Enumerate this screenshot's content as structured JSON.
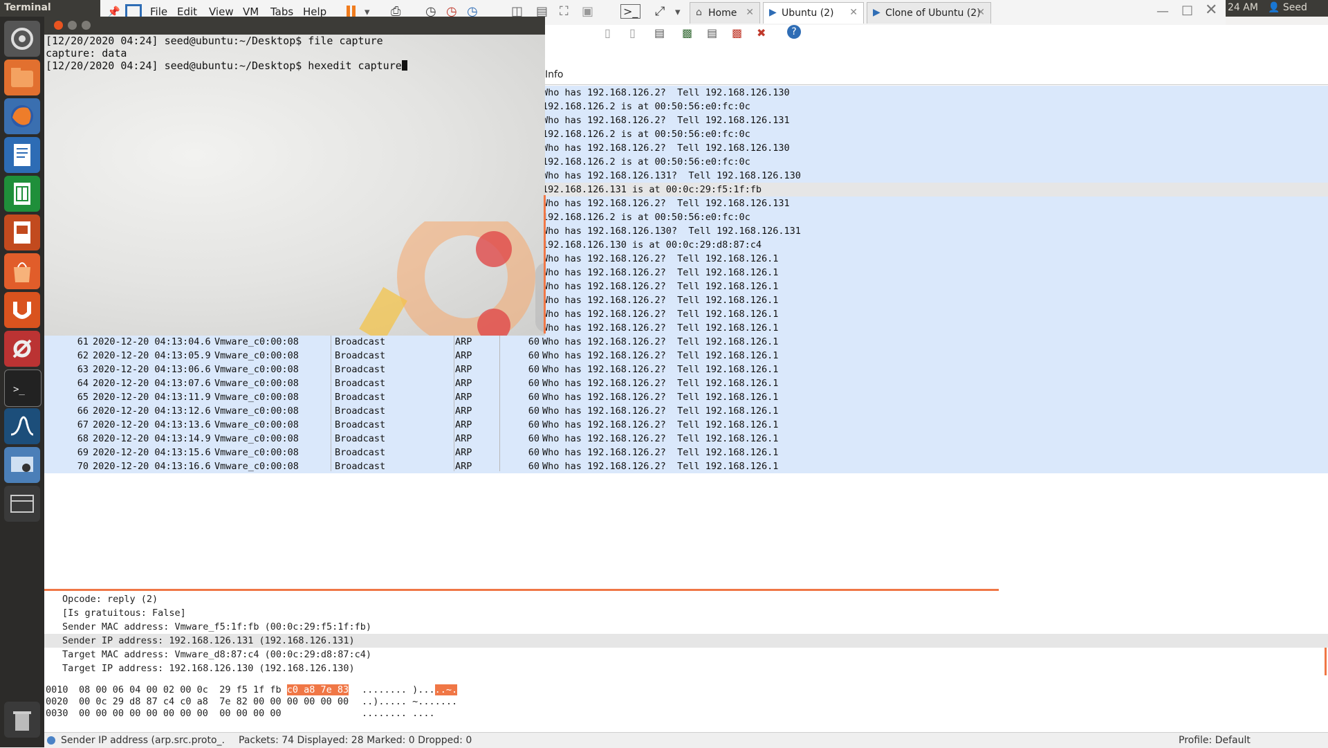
{
  "top_panel": {
    "app_title": "Terminal",
    "clock": "24 AM",
    "user": "Seed"
  },
  "vmware": {
    "menus": [
      "File",
      "Edit",
      "View",
      "VM",
      "Tabs",
      "Help"
    ],
    "tabs": [
      {
        "label": "Home",
        "icon": "home-icon"
      },
      {
        "label": "Ubuntu (2)",
        "icon": "vm-play-icon"
      },
      {
        "label": "Clone of Ubuntu (2)",
        "icon": "vm-play-icon"
      }
    ]
  },
  "terminal": {
    "lines": [
      "[12/20/2020 04:24] seed@ubuntu:~/Desktop$ file capture",
      "capture: data",
      "[12/20/2020 04:24] seed@ubuntu:~/Desktop$ hexedit capture"
    ]
  },
  "packet_list": {
    "column_header": "Info",
    "hidden_rows_info": [
      "Who has 192.168.126.2?  Tell 192.168.126.130",
      "192.168.126.2 is at 00:50:56:e0:fc:0c",
      "Who has 192.168.126.2?  Tell 192.168.126.131",
      "192.168.126.2 is at 00:50:56:e0:fc:0c",
      "Who has 192.168.126.2?  Tell 192.168.126.130",
      "192.168.126.2 is at 00:50:56:e0:fc:0c",
      "Who has 192.168.126.131?  Tell 192.168.126.130",
      "192.168.126.131 is at 00:0c:29:f5:1f:fb",
      "Who has 192.168.126.2?  Tell 192.168.126.131",
      "192.168.126.2 is at 00:50:56:e0:fc:0c",
      "Who has 192.168.126.130?  Tell 192.168.126.131",
      "192.168.126.130 is at 00:0c:29:d8:87:c4",
      "Who has 192.168.126.2?  Tell 192.168.126.1",
      "Who has 192.168.126.2?  Tell 192.168.126.1",
      "Who has 192.168.126.2?  Tell 192.168.126.1",
      "Who has 192.168.126.2?  Tell 192.168.126.1",
      "Who has 192.168.126.2?  Tell 192.168.126.1",
      "Who has 192.168.126.2?  Tell 192.168.126.1"
    ],
    "rows": [
      {
        "no": "61",
        "time": "2020-12-20 04:13:04.6",
        "src": "Vmware_c0:00:08",
        "dst": "Broadcast",
        "proto": "ARP",
        "len": "60",
        "info": "Who has 192.168.126.2?  Tell 192.168.126.1"
      },
      {
        "no": "62",
        "time": "2020-12-20 04:13:05.9",
        "src": "Vmware_c0:00:08",
        "dst": "Broadcast",
        "proto": "ARP",
        "len": "60",
        "info": "Who has 192.168.126.2?  Tell 192.168.126.1"
      },
      {
        "no": "63",
        "time": "2020-12-20 04:13:06.6",
        "src": "Vmware_c0:00:08",
        "dst": "Broadcast",
        "proto": "ARP",
        "len": "60",
        "info": "Who has 192.168.126.2?  Tell 192.168.126.1"
      },
      {
        "no": "64",
        "time": "2020-12-20 04:13:07.6",
        "src": "Vmware_c0:00:08",
        "dst": "Broadcast",
        "proto": "ARP",
        "len": "60",
        "info": "Who has 192.168.126.2?  Tell 192.168.126.1"
      },
      {
        "no": "65",
        "time": "2020-12-20 04:13:11.9",
        "src": "Vmware_c0:00:08",
        "dst": "Broadcast",
        "proto": "ARP",
        "len": "60",
        "info": "Who has 192.168.126.2?  Tell 192.168.126.1"
      },
      {
        "no": "66",
        "time": "2020-12-20 04:13:12.6",
        "src": "Vmware_c0:00:08",
        "dst": "Broadcast",
        "proto": "ARP",
        "len": "60",
        "info": "Who has 192.168.126.2?  Tell 192.168.126.1"
      },
      {
        "no": "67",
        "time": "2020-12-20 04:13:13.6",
        "src": "Vmware_c0:00:08",
        "dst": "Broadcast",
        "proto": "ARP",
        "len": "60",
        "info": "Who has 192.168.126.2?  Tell 192.168.126.1"
      },
      {
        "no": "68",
        "time": "2020-12-20 04:13:14.9",
        "src": "Vmware_c0:00:08",
        "dst": "Broadcast",
        "proto": "ARP",
        "len": "60",
        "info": "Who has 192.168.126.2?  Tell 192.168.126.1"
      },
      {
        "no": "69",
        "time": "2020-12-20 04:13:15.6",
        "src": "Vmware_c0:00:08",
        "dst": "Broadcast",
        "proto": "ARP",
        "len": "60",
        "info": "Who has 192.168.126.2?  Tell 192.168.126.1"
      },
      {
        "no": "70",
        "time": "2020-12-20 04:13:16.6",
        "src": "Vmware_c0:00:08",
        "dst": "Broadcast",
        "proto": "ARP",
        "len": "60",
        "info": "Who has 192.168.126.2?  Tell 192.168.126.1"
      }
    ]
  },
  "packet_details": [
    "Opcode: reply (2)",
    "[Is gratuitous: False]",
    "Sender MAC address: Vmware_f5:1f:fb (00:0c:29:f5:1f:fb)",
    "Sender IP address: 192.168.126.131 (192.168.126.131)",
    "Target MAC address: Vmware_d8:87:c4 (00:0c:29:d8:87:c4)",
    "Target IP address: 192.168.126.130 (192.168.126.130)"
  ],
  "hex_dump": [
    {
      "offset": "0010",
      "bytes_a": "08 00 06 04 00 02 00 0c  29 f5 1f fb ",
      "bytes_hl": "c0 a8 7e 83",
      "ascii_a": "........ )...",
      "ascii_hl": "..~."
    },
    {
      "offset": "0020",
      "bytes_a": "00 0c 29 d8 87 c4 c0 a8  7e 82 00 00 00 00 00 00",
      "bytes_hl": "",
      "ascii_a": "..)..... ~.......",
      "ascii_hl": ""
    },
    {
      "offset": "0030",
      "bytes_a": "00 00 00 00 00 00 00 00  00 00 00 00",
      "bytes_hl": "",
      "ascii_a": "........ ....",
      "ascii_hl": ""
    }
  ],
  "status": {
    "field": "Sender IP address (arp.src.proto_...",
    "counts": "Packets: 74 Displayed: 28 Marked: 0 Dropped: 0",
    "profile": "Profile: Default"
  },
  "colors": {
    "row_bg": "#dae8fb",
    "selected_bg": "#e6e6e6",
    "accent": "#f07746",
    "launcher_bg": "#2c2b29"
  }
}
